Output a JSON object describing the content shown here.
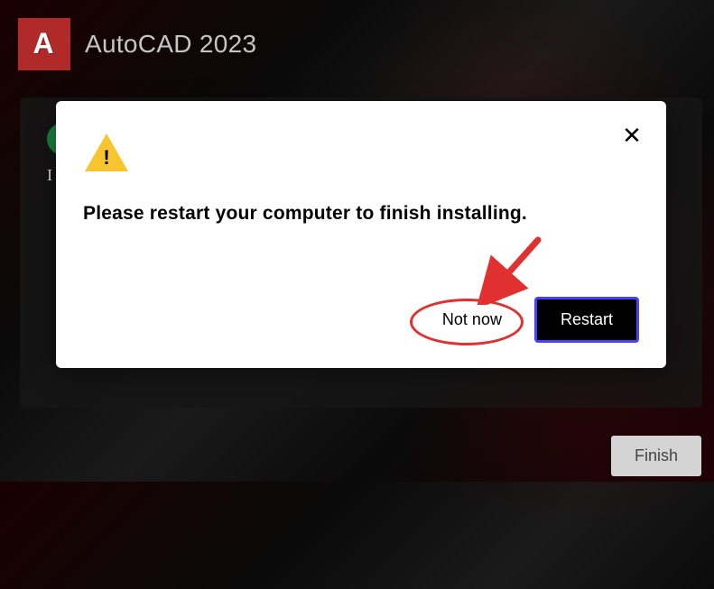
{
  "header": {
    "logo_letter": "A",
    "app_title": "AutoCAD 2023"
  },
  "status": {
    "check_glyph": "✓",
    "label": "I"
  },
  "dialog": {
    "message": "Please restart your computer to finish installing.",
    "not_now_label": "Not now",
    "restart_label": "Restart",
    "close_glyph": "✕",
    "warning_exclaim": "!"
  },
  "footer": {
    "finish_label": "Finish"
  },
  "colors": {
    "logo_bg": "#b02a2a",
    "warning": "#f7c52d",
    "restart_border": "#4a3fff",
    "annotation": "#e03030"
  }
}
